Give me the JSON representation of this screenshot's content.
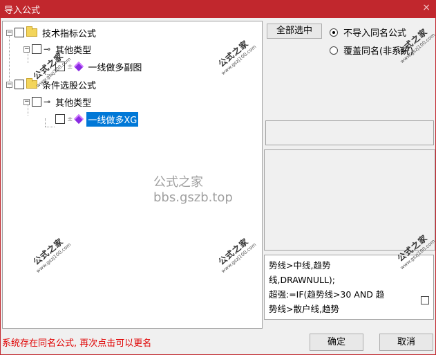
{
  "window": {
    "title": "导入公式",
    "close_glyph": "×"
  },
  "tree": {
    "nodes": [
      {
        "label": "技术指标公式"
      },
      {
        "label": "其他类型"
      },
      {
        "label": "一线做多副图"
      },
      {
        "label": "条件选股公式"
      },
      {
        "label": "其他类型"
      },
      {
        "label": "一线做多XG",
        "selected": true
      }
    ]
  },
  "watermark": {
    "center": "公式之家 bbs.gszb.top",
    "stamp_cn": "公式之家",
    "stamp_url": "www.gszj100.com"
  },
  "actions": {
    "select_all": "全部选中",
    "radio_skip": "不导入同名公式",
    "radio_overwrite": "覆盖同名(非系统)",
    "ok": "确定",
    "cancel": "取消"
  },
  "code": {
    "lines": [
      "势线>中线,趋势",
      "线,DRAWNULL);",
      "超强:=IF(趋势线>30 AND 趋",
      "势线>散户线,趋势"
    ]
  },
  "status_text": "系统存在同名公式, 再次点击可以更名",
  "colors": {
    "titlebar": "#c1272d",
    "selection": "#0078d7",
    "status": "#e00000"
  }
}
